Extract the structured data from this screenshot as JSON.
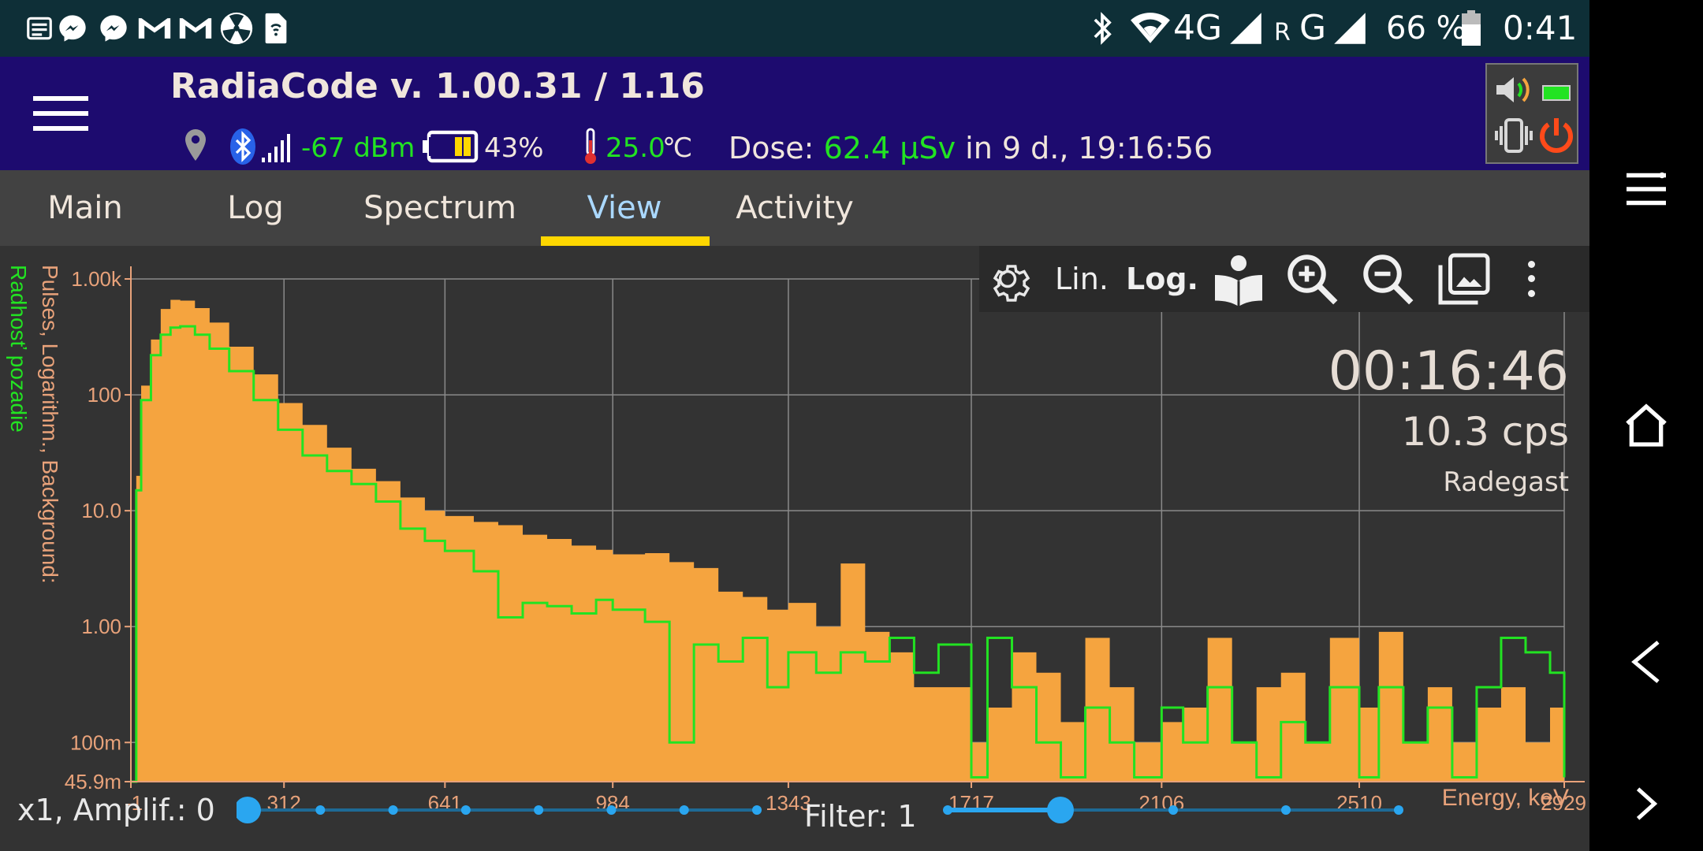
{
  "status_bar": {
    "left_icons": [
      "news-icon",
      "messenger-icon",
      "messenger-icon",
      "gmail-icon",
      "gmail-icon",
      "radiation-icon",
      "sim-card-icon"
    ],
    "network_label": "4G",
    "roaming_label": "R",
    "network2_label": "G",
    "battery_percent": "66 %",
    "time": "0:41"
  },
  "app_bar": {
    "title": "RadiaCode v. 1.00.31 / 1.16",
    "signal": "-67 dBm",
    "battery": "43%",
    "battery_level": 0.43,
    "temperature": "25.0",
    "temperature_unit": "℃",
    "dose_label": "Dose:",
    "dose_value": "62.4 µSv",
    "dose_period": "in 9 d., 19:16:56",
    "colors": {
      "accent_green": "#22e322",
      "bar_bg": "#1d0b6f",
      "power_red": "#ff4a1a"
    }
  },
  "tabs": [
    {
      "label": "Main",
      "active": false
    },
    {
      "label": "Log",
      "active": false
    },
    {
      "label": "Spectrum",
      "active": false
    },
    {
      "label": "View",
      "active": true
    },
    {
      "label": "Activity",
      "active": false
    }
  ],
  "toolbar": {
    "lin_label": "Lin.",
    "log_label": "Log."
  },
  "overlay": {
    "elapsed": "00:16:46",
    "rate": "10.3 cps",
    "background_name": "Radegast"
  },
  "controls": {
    "amplif_label": "x1, Amplif.: 0",
    "amplif_level": 0,
    "filter_label": "Filter: 1",
    "filter_level": 1
  },
  "chart_data": {
    "type": "area",
    "ylabel": "Pulses, Logarithm., Background:",
    "ylabel2": "Radhosť pozadie",
    "xlabel": "Energy, keV",
    "y_scale": "log",
    "ylim": [
      0.0459,
      1000
    ],
    "xlim": [
      -1,
      2929
    ],
    "x_ticks": [
      "-1",
      "312",
      "641",
      "984",
      "1343",
      "1717",
      "2106",
      "2510",
      "2929"
    ],
    "y_ticks": [
      "1.00k",
      "100",
      "10.0",
      "1.00",
      "100m",
      "45.9m"
    ],
    "grid": true,
    "series": [
      {
        "name": "Pulses",
        "style": "filled-area",
        "color": "#f5a43f",
        "x": [
          -1,
          10,
          20,
          40,
          60,
          80,
          100,
          130,
          160,
          200,
          250,
          300,
          350,
          400,
          450,
          500,
          550,
          600,
          641,
          700,
          750,
          800,
          850,
          900,
          950,
          984,
          1050,
          1100,
          1150,
          1200,
          1250,
          1300,
          1343,
          1400,
          1450,
          1500,
          1550,
          1600,
          1650,
          1717,
          1750,
          1800,
          1850,
          1900,
          1950,
          2000,
          2050,
          2106,
          2150,
          2200,
          2250,
          2300,
          2350,
          2400,
          2450,
          2510,
          2550,
          2600,
          2650,
          2700,
          2750,
          2800,
          2850,
          2900,
          2929
        ],
        "y": [
          0.0459,
          20,
          120,
          300,
          550,
          660,
          650,
          560,
          420,
          260,
          150,
          85,
          55,
          35,
          23,
          18,
          13,
          10,
          9,
          8,
          7.5,
          6.2,
          5.7,
          5,
          4.6,
          4.2,
          4.3,
          3.6,
          3.2,
          2.0,
          1.8,
          1.4,
          1.6,
          1.0,
          3.5,
          0.9,
          0.6,
          0.3,
          0.3,
          0.1,
          0.2,
          0.6,
          0.4,
          0.15,
          0.8,
          0.3,
          0.1,
          0.15,
          0.2,
          0.8,
          0.1,
          0.3,
          0.4,
          0.1,
          0.8,
          0.2,
          0.9,
          0.1,
          0.3,
          0.1,
          0.2,
          0.3,
          0.1,
          0.2,
          0.0459
        ]
      },
      {
        "name": "Background",
        "style": "line",
        "color": "#22e322",
        "x": [
          -1,
          10,
          20,
          40,
          60,
          80,
          100,
          130,
          160,
          200,
          250,
          300,
          350,
          400,
          450,
          500,
          550,
          600,
          641,
          700,
          750,
          800,
          850,
          900,
          950,
          984,
          1050,
          1100,
          1150,
          1200,
          1250,
          1300,
          1343,
          1400,
          1450,
          1500,
          1550,
          1600,
          1650,
          1717,
          1750,
          1800,
          1850,
          1900,
          1950,
          2000,
          2050,
          2106,
          2150,
          2200,
          2250,
          2300,
          2350,
          2400,
          2450,
          2510,
          2550,
          2600,
          2650,
          2700,
          2750,
          2800,
          2850,
          2900,
          2929
        ],
        "y": [
          0.0459,
          15,
          90,
          220,
          330,
          380,
          390,
          330,
          250,
          160,
          90,
          50,
          30,
          22,
          17,
          12,
          7,
          5.5,
          4.5,
          3,
          1.2,
          1.6,
          1.5,
          1.3,
          1.7,
          1.4,
          1.1,
          0.1,
          0.7,
          0.5,
          0.8,
          0.3,
          0.6,
          0.4,
          0.6,
          0.5,
          0.8,
          0.4,
          0.7,
          0.05,
          0.8,
          0.3,
          0.1,
          0.05,
          0.2,
          0.1,
          0.05,
          0.2,
          0.1,
          0.3,
          0.1,
          0.05,
          0.15,
          0.1,
          0.3,
          0.05,
          0.3,
          0.1,
          0.2,
          0.05,
          0.3,
          0.8,
          0.6,
          0.4,
          0.05
        ]
      }
    ]
  }
}
